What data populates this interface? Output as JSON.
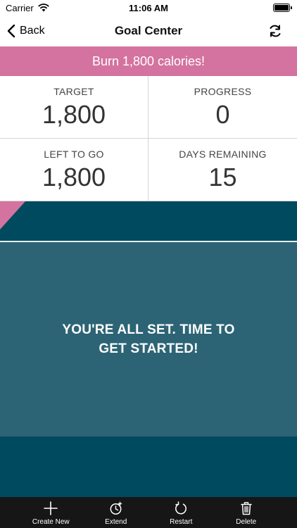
{
  "status_bar": {
    "carrier": "Carrier",
    "time": "11:06 AM"
  },
  "nav": {
    "back_label": "Back",
    "title": "Goal Center"
  },
  "goal": {
    "banner_text": "Burn 1,800 calories!",
    "banner_color": "#d4739f"
  },
  "stats": [
    {
      "label": "TARGET",
      "value": "1,800"
    },
    {
      "label": "PROGRESS",
      "value": "0"
    },
    {
      "label": "LEFT TO GO",
      "value": "1,800"
    },
    {
      "label": "DAYS REMAINING",
      "value": "15"
    }
  ],
  "message": {
    "text": "YOU'RE ALL SET. TIME TO GET STARTED!"
  },
  "colors": {
    "accent_pink": "#d4739f",
    "dark_teal": "#004a60",
    "mid_teal": "#2c6475",
    "tab_bar": "#161616"
  },
  "tab_bar": {
    "items": [
      {
        "label": "Create New",
        "icon": "plus-icon"
      },
      {
        "label": "Extend",
        "icon": "clock-add-icon"
      },
      {
        "label": "Restart",
        "icon": "restart-icon"
      },
      {
        "label": "Delete",
        "icon": "trash-icon"
      }
    ]
  }
}
